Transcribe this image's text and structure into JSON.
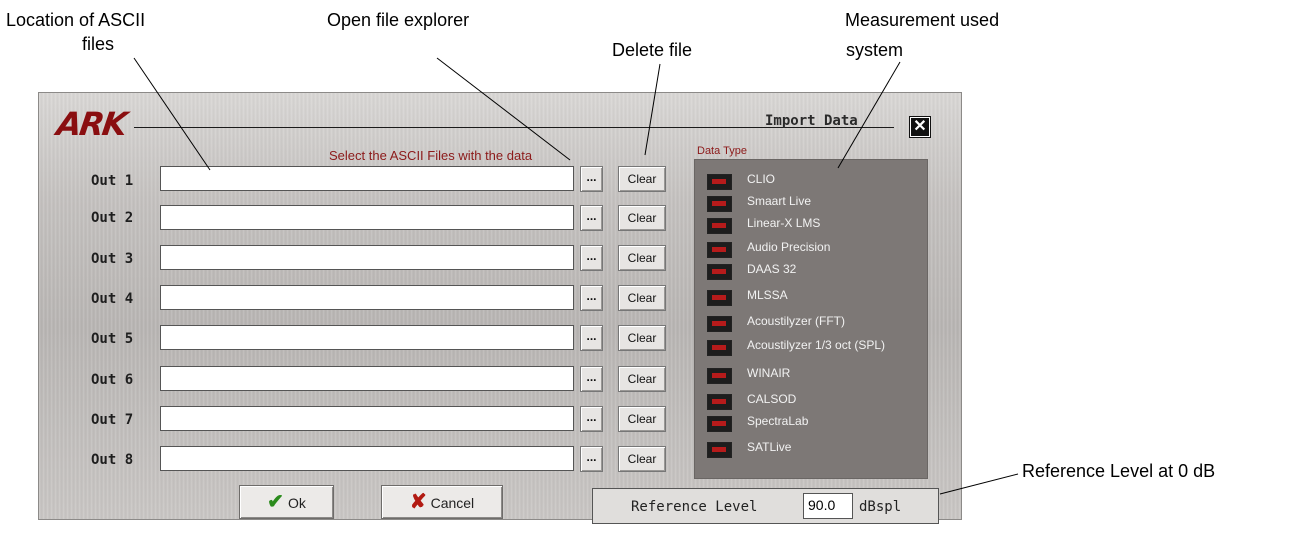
{
  "annotations": {
    "location": "Location of ASCII",
    "location2": "files",
    "explorer": "Open file explorer",
    "delete": "Delete file",
    "measure": "Measurement used",
    "measure2": "system",
    "reference": "Reference Level at 0 dB"
  },
  "dialog": {
    "logo": "ARK",
    "title": "Import Data",
    "close_glyph": "✕",
    "select_label": "Select the ASCII Files with the data",
    "outputs": [
      {
        "label": "Out 1",
        "value": "",
        "browse": "...",
        "clear": "Clear"
      },
      {
        "label": "Out 2",
        "value": "",
        "browse": "...",
        "clear": "Clear"
      },
      {
        "label": "Out 3",
        "value": "",
        "browse": "...",
        "clear": "Clear"
      },
      {
        "label": "Out 4",
        "value": "",
        "browse": "...",
        "clear": "Clear"
      },
      {
        "label": "Out 5",
        "value": "",
        "browse": "...",
        "clear": "Clear"
      },
      {
        "label": "Out 6",
        "value": "",
        "browse": "...",
        "clear": "Clear"
      },
      {
        "label": "Out 7",
        "value": "",
        "browse": "...",
        "clear": "Clear"
      },
      {
        "label": "Out 8",
        "value": "",
        "browse": "...",
        "clear": "Clear"
      }
    ],
    "data_type_label": "Data Type",
    "data_types": [
      "CLIO",
      "Smaart Live",
      "Linear-X LMS",
      "Audio Precision",
      "DAAS 32",
      "MLSSA",
      "Acoustilyzer (FFT)",
      "Acoustilyzer 1/3 oct (SPL)",
      "WINAIR",
      "CALSOD",
      "SpectraLab",
      "SATLive"
    ],
    "ok_label": "Ok",
    "cancel_label": "Cancel",
    "reference_label": "Reference Level",
    "reference_value": "90.0",
    "reference_unit": "dBspl"
  },
  "colors": {
    "logo": "#8a0e10",
    "led": "#b61b1b",
    "panel": "#7d7876",
    "label_red": "#8c1a1a"
  }
}
